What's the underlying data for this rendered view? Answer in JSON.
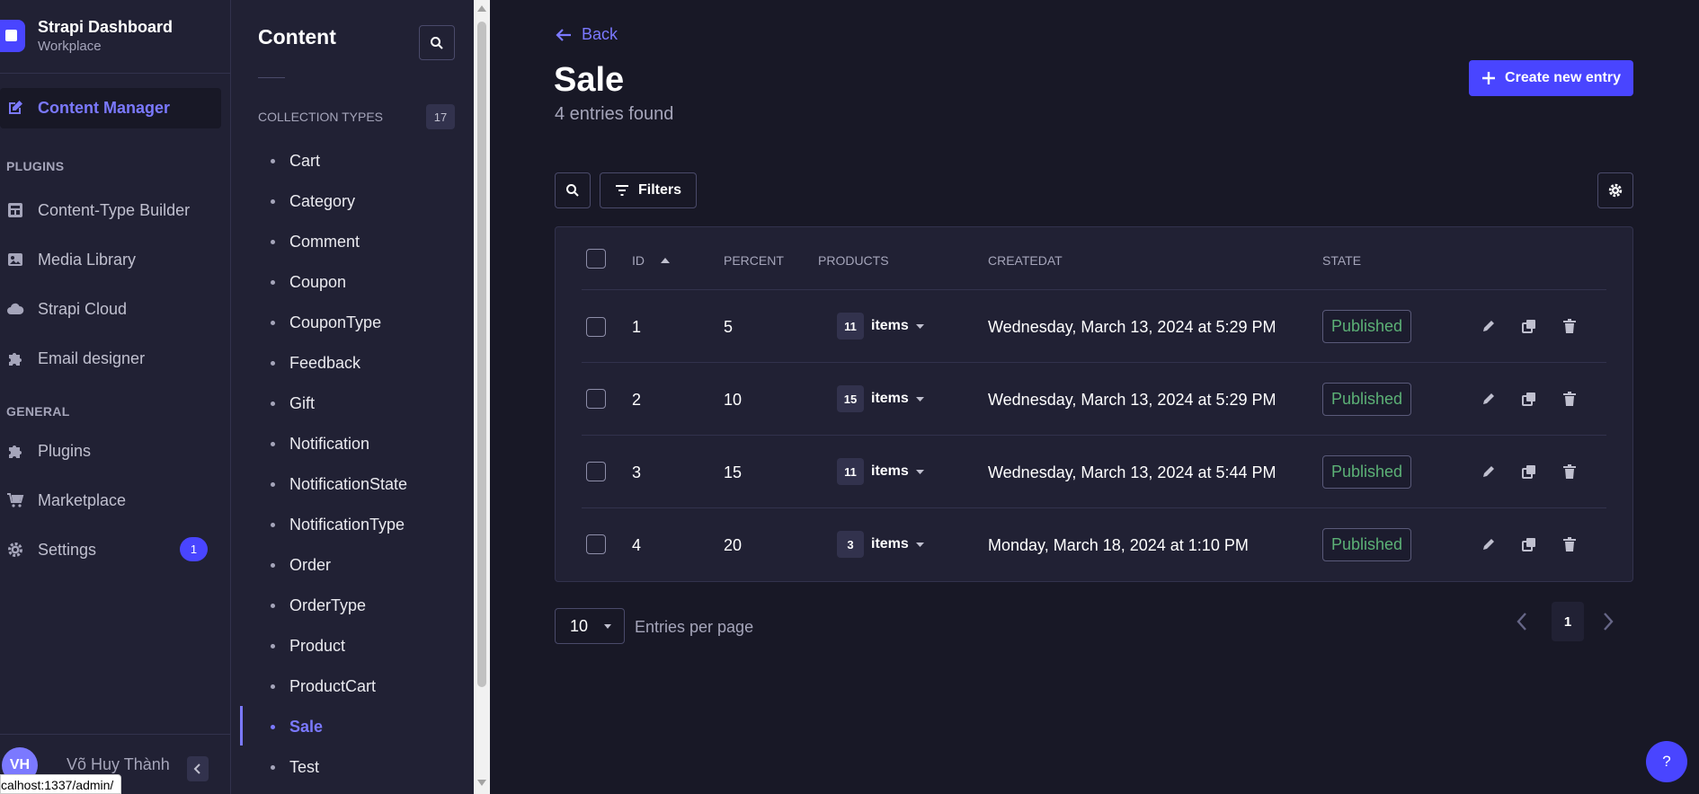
{
  "brand": {
    "title": "Strapi Dashboard",
    "subtitle": "Workplace"
  },
  "mainnav": {
    "content_manager": "Content Manager",
    "plugins_section": "PLUGINS",
    "content_type_builder": "Content-Type Builder",
    "media_library": "Media Library",
    "strapi_cloud": "Strapi Cloud",
    "email_designer": "Email designer",
    "general_section": "GENERAL",
    "plugins": "Plugins",
    "marketplace": "Marketplace",
    "settings": "Settings",
    "settings_badge": "1"
  },
  "user": {
    "initials": "VH",
    "name": "Võ Huy Thành"
  },
  "status_url": "calhost:1337/admin/",
  "subnav": {
    "title": "Content",
    "collection_header": "Collection Types",
    "collection_count": "17",
    "items": [
      "Cart",
      "Category",
      "Comment",
      "Coupon",
      "CouponType",
      "Feedback",
      "Gift",
      "Notification",
      "NotificationState",
      "NotificationType",
      "Order",
      "OrderType",
      "Product",
      "ProductCart",
      "Sale",
      "Test"
    ],
    "active_item": "Sale"
  },
  "header": {
    "back": "Back",
    "title": "Sale",
    "subtitle": "4 entries found",
    "create_button": "Create new entry"
  },
  "toolbar": {
    "filters": "Filters"
  },
  "table": {
    "columns": {
      "id": "ID",
      "percent": "PERCENT",
      "products": "PRODUCTS",
      "createdat": "CREATEDAT",
      "state": "STATE"
    },
    "items_label": "items",
    "rows": [
      {
        "id": "1",
        "percent": "5",
        "products": "11",
        "createdat": "Wednesday, March 13, 2024 at 5:29 PM",
        "state": "Published"
      },
      {
        "id": "2",
        "percent": "10",
        "products": "15",
        "createdat": "Wednesday, March 13, 2024 at 5:29 PM",
        "state": "Published"
      },
      {
        "id": "3",
        "percent": "15",
        "products": "11",
        "createdat": "Wednesday, March 13, 2024 at 5:44 PM",
        "state": "Published"
      },
      {
        "id": "4",
        "percent": "20",
        "products": "3",
        "createdat": "Monday, March 18, 2024 at 1:10 PM",
        "state": "Published"
      }
    ]
  },
  "pagination": {
    "per_page": "10",
    "per_page_label": "Entries per page",
    "current_page": "1"
  },
  "help": "?",
  "colors": {
    "accent": "#4945ff",
    "accent_text": "#7b79ff",
    "published": "#5cb176",
    "background": "#181826",
    "panel": "#212134"
  }
}
